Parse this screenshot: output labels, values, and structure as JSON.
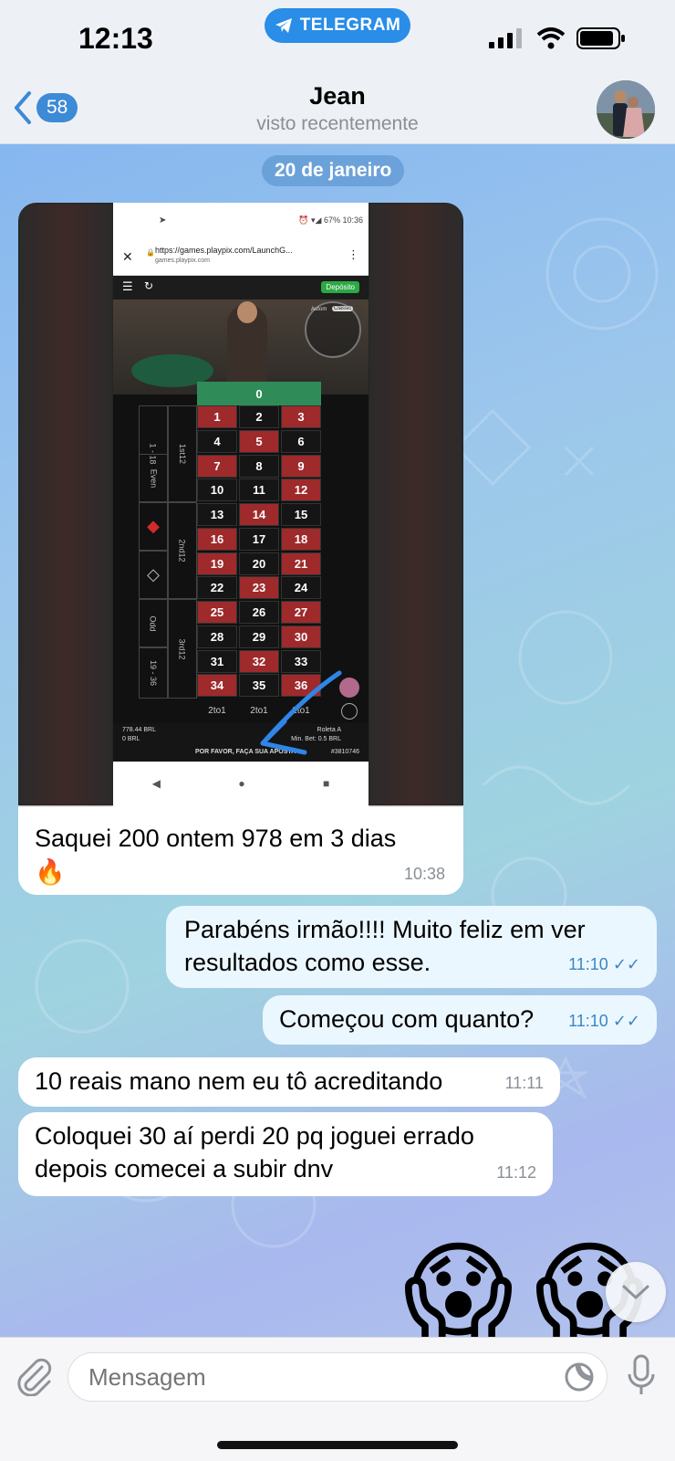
{
  "status": {
    "time": "12:13",
    "pill_label": "TELEGRAM"
  },
  "header": {
    "back_count": "58",
    "name": "Jean",
    "presence": "visto recentemente"
  },
  "date_separator": "20 de janeiro",
  "image_message": {
    "caption": "Saquei 200 ontem 978 em 3 dias",
    "caption_emoji": "🔥",
    "time": "10:38",
    "screenshot": {
      "status_right": "⏰ ▾◢ 67% 10:36",
      "url": "https://games.playpix.com/LaunchG...",
      "domain": "games.playpix.com",
      "deposit": "Depósito",
      "zero": "0",
      "rows": [
        [
          "1",
          "2",
          "3"
        ],
        [
          "4",
          "5",
          "6"
        ],
        [
          "7",
          "8",
          "9"
        ],
        [
          "10",
          "11",
          "12"
        ],
        [
          "13",
          "14",
          "15"
        ],
        [
          "16",
          "17",
          "18"
        ],
        [
          "19",
          "20",
          "21"
        ],
        [
          "22",
          "23",
          "24"
        ],
        [
          "25",
          "26",
          "27"
        ],
        [
          "28",
          "29",
          "30"
        ],
        [
          "31",
          "32",
          "33"
        ],
        [
          "34",
          "35",
          "36"
        ]
      ],
      "reds": [
        "1",
        "3",
        "5",
        "7",
        "9",
        "12",
        "14",
        "16",
        "18",
        "19",
        "21",
        "23",
        "25",
        "27",
        "30",
        "32",
        "34",
        "36"
      ],
      "side_labels": {
        "low": "1 - 18",
        "even": "Even",
        "odd": "Odd",
        "high": "19 - 36",
        "d1": "1st12",
        "d2": "2nd12",
        "d3": "3rd12"
      },
      "col_label": "2to1",
      "balance": "778.44 BRL",
      "bet": "0 BRL",
      "table": "Roleta A",
      "min_bet": "Min. Bet: 0.5 BRL",
      "prompt": "POR FAVOR, FAÇA SUA APOSTA",
      "round": "#3810746",
      "autom": "Autom",
      "classic": "Classic"
    }
  },
  "messages": [
    {
      "dir": "out",
      "text_line1": "Parabéns irmão!!!! Muito feliz em ver",
      "text_line2": "resultados como esse.",
      "time": "11:10"
    },
    {
      "dir": "out",
      "text": "Começou com quanto?",
      "time": "11:10"
    },
    {
      "dir": "in",
      "text": "10 reais mano nem eu tô acreditando",
      "time": "11:11"
    },
    {
      "dir": "in",
      "text_line1": "Coloquei 30 aí perdi 20 pq joguei errado",
      "text_line2": "depois comecei a subir dnv",
      "time": "11:12"
    }
  ],
  "emojis": [
    "😱",
    "😱"
  ],
  "composer": {
    "placeholder": "Mensagem"
  },
  "colors": {
    "accent": "#2a8de8",
    "outgoing_bubble": "#ebf7ff",
    "check_color": "#3b86c5"
  }
}
